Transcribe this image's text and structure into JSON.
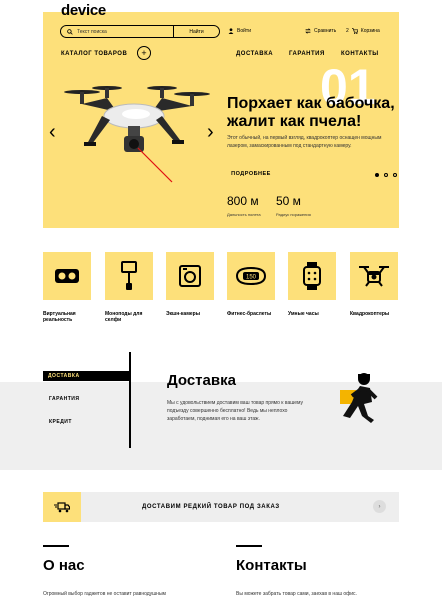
{
  "header": {
    "logo": "device",
    "search_placeholder": "Текст поиска",
    "search_button": "Найти",
    "login": "Войти",
    "compare": "Сравнить",
    "cart": "Корзина",
    "cart_count": "2"
  },
  "nav": {
    "catalog": "КАТАЛОГ ТОВАРОВ",
    "plus": "+",
    "items": [
      "ДОСТАВКА",
      "ГАРАНТИЯ",
      "КОНТАКТЫ"
    ]
  },
  "hero": {
    "number": "01",
    "title": "Порхает как бабочка, жалит как пчела!",
    "description": "Этот обычный, на первый взгляд, квадрокоптер оснащен мощным лазером, замаскированным под стандартную камеру.",
    "more": "ПОДРОБНЕЕ",
    "stats": [
      {
        "value": "800 м",
        "label": "Дальность полета"
      },
      {
        "value": "50 м",
        "label": "Радиус поражения"
      }
    ],
    "prev": "‹",
    "next": "›",
    "active_slide": 1
  },
  "categories": [
    {
      "label": "Виртуальная реальность",
      "icon": "vr-headset-icon"
    },
    {
      "label": "Моноподы для селфи",
      "icon": "selfie-stick-icon"
    },
    {
      "label": "Экшн-камеры",
      "icon": "action-camera-icon"
    },
    {
      "label": "Фитнес-браслеты",
      "icon": "fitness-band-icon",
      "band_text": "150"
    },
    {
      "label": "Умные часы",
      "icon": "smart-watch-icon"
    },
    {
      "label": "Квадрокоптеры",
      "icon": "drone-icon"
    }
  ],
  "services": {
    "tabs": [
      "ДОСТАВКА",
      "ГАРАНТИЯ",
      "КРЕДИТ"
    ],
    "title": "Доставка",
    "description": "Мы с удовольствием доставим ваш товар прямо к вашему подъезду совершенно бесплатно! Ведь мы неплохо заработаем, поднимая его на ваш этаж."
  },
  "banner": {
    "text": "ДОСТАВИМ РЕДКИЙ ТОВАР ПОД ЗАКАЗ",
    "button": "›"
  },
  "about": {
    "title": "О нас",
    "text": "Огромный выбор гаджетов не оставит равнодушным"
  },
  "contacts": {
    "title": "Контакты",
    "text": "Вы можете забрать товар сами, заехав в наш офис."
  },
  "colors": {
    "accent": "#fde07a",
    "grey": "#efefef"
  }
}
